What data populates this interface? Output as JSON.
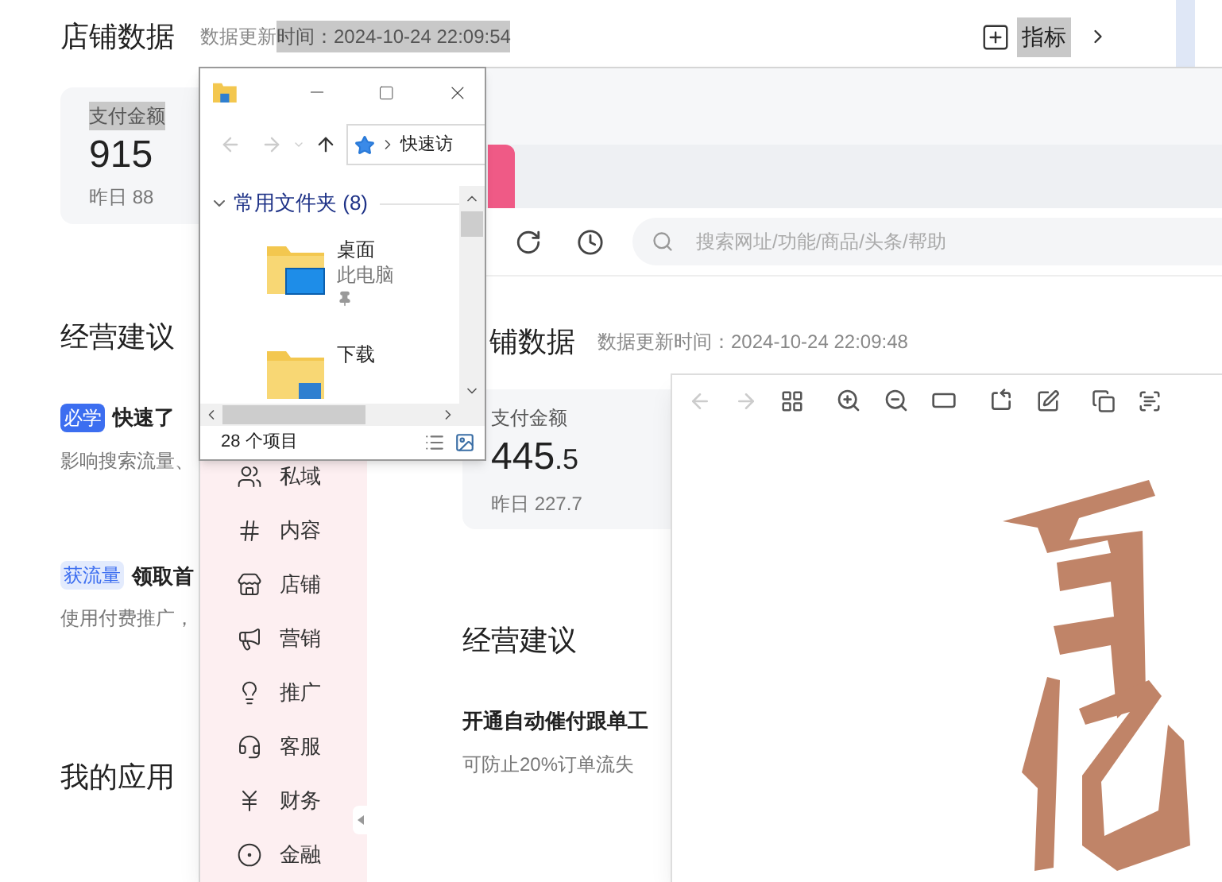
{
  "store_page": {
    "title": "店铺数据",
    "update_time": {
      "plain": "数据更新",
      "highlighted": "时间：2024-10-24 22:09:54"
    },
    "metrics_button": {
      "label": "指标",
      "highlighted": true
    },
    "metric": {
      "label": "支付金额",
      "highlighted": true,
      "value": "915",
      "yesterday": "昨日 88"
    },
    "advice_title": "经营建议",
    "advice": [
      {
        "tag": "必学",
        "kind": "solid",
        "title": "快速了",
        "desc": "影响搜索流量、"
      },
      {
        "tag": "获流量",
        "kind": "soft",
        "title": "领取首",
        "desc": "使用付费推广，"
      }
    ],
    "apps_title": "我的应用"
  },
  "browser": {
    "search_placeholder": "搜索网址/功能/商品/头条/帮助",
    "sidebar": [
      {
        "label": "私域"
      },
      {
        "label": "内容"
      },
      {
        "label": "店铺"
      },
      {
        "label": "营销"
      },
      {
        "label": "推广"
      },
      {
        "label": "客服"
      },
      {
        "label": "财务"
      },
      {
        "label": "金融"
      }
    ],
    "page": {
      "title": "铺数据",
      "update_time": "数据更新时间：2024-10-24 22:09:48",
      "metric": {
        "label": "支付金额",
        "value_whole": "445",
        "value_fraction": ".5",
        "yesterday": "昨日 227.7"
      },
      "advice_title": "经营建议",
      "advice": {
        "title": "开通自动催付跟单工",
        "desc": "可防止20%订单流失"
      }
    }
  },
  "explorer": {
    "address": "快速访",
    "group": {
      "label": "常用文件夹 (8)",
      "expanded": true
    },
    "items": [
      {
        "name": "桌面",
        "location": "此电脑",
        "pinned": true
      },
      {
        "name": "下载",
        "pinned": false
      }
    ],
    "status": "28 个项目"
  }
}
